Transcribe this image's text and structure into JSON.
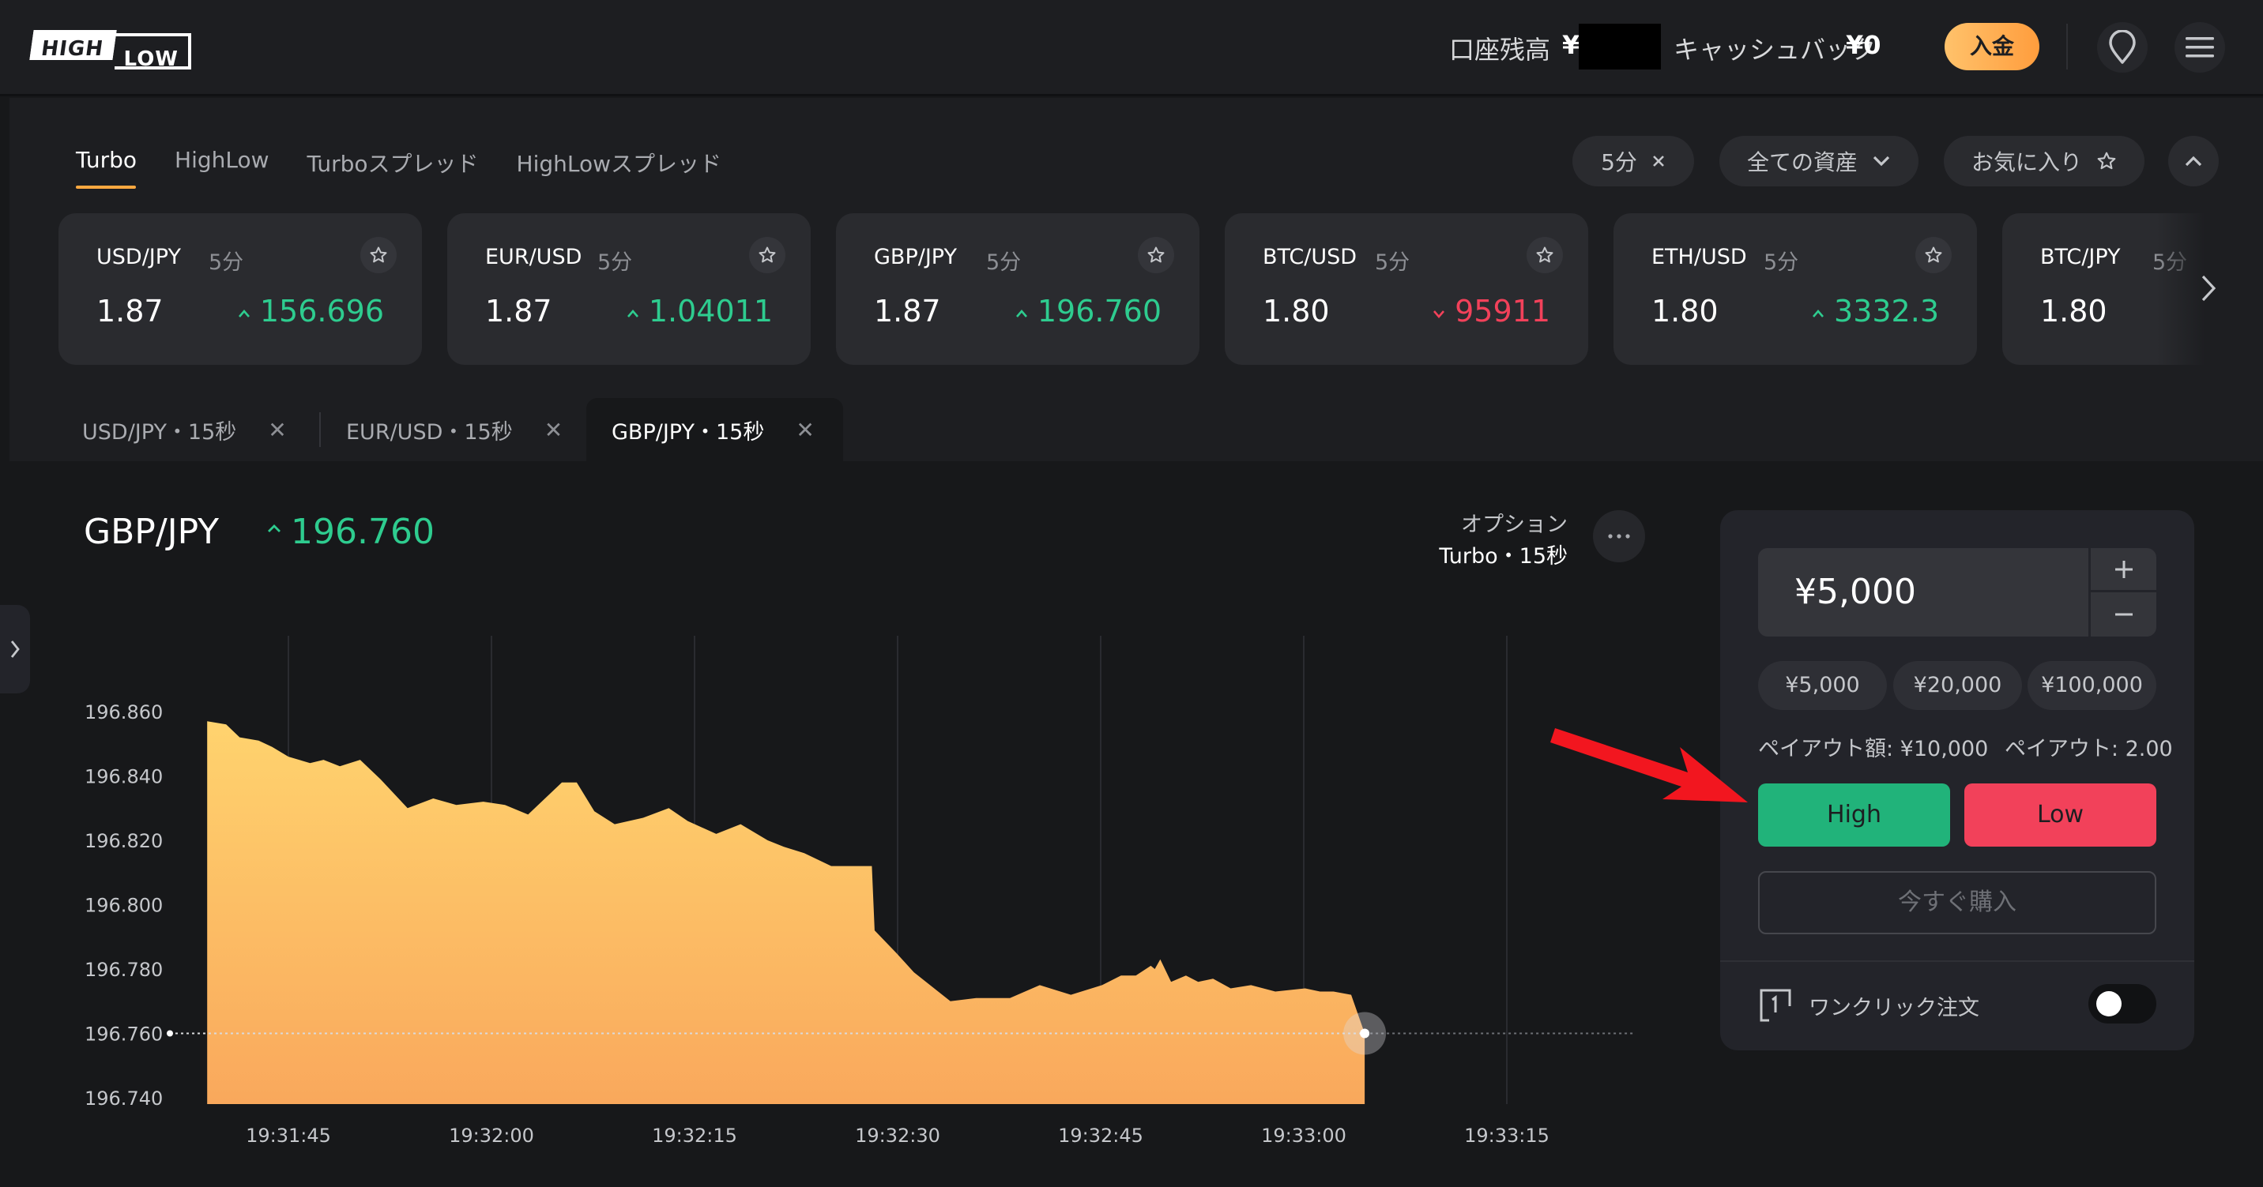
{
  "header": {
    "logo_top": "HIGH",
    "logo_bottom": "LOW",
    "balance_label": "口座残高",
    "balance_currency": "¥",
    "cashback_label": "キャッシュバック",
    "cashback_value": "¥0",
    "deposit_label": "入金",
    "icons": [
      "location-pin-icon",
      "menu-icon"
    ]
  },
  "trade_type_tabs": [
    {
      "label": "Turbo",
      "active": true
    },
    {
      "label": "HighLow",
      "active": false
    },
    {
      "label": "Turboスプレッド",
      "active": false
    },
    {
      "label": "HighLowスプレッド",
      "active": false
    }
  ],
  "filters": {
    "duration": "5分",
    "assets": "全ての資産",
    "favorites": "お気に入り"
  },
  "asset_cards": [
    {
      "pair": "USD/JPY",
      "duration": "5分",
      "payout": "1.87",
      "price": "156.696",
      "direction": "up"
    },
    {
      "pair": "EUR/USD",
      "duration": "5分",
      "payout": "1.87",
      "price": "1.04011",
      "direction": "up"
    },
    {
      "pair": "GBP/JPY",
      "duration": "5分",
      "payout": "1.87",
      "price": "196.760",
      "direction": "up"
    },
    {
      "pair": "BTC/USD",
      "duration": "5分",
      "payout": "1.80",
      "price": "95911",
      "direction": "down"
    },
    {
      "pair": "ETH/USD",
      "duration": "5分",
      "payout": "1.80",
      "price": "3332.3",
      "direction": "up"
    },
    {
      "pair": "BTC/JPY",
      "duration": "5分",
      "payout": "1.80",
      "price": "",
      "direction": "up"
    }
  ],
  "chart_tabs": [
    {
      "label": "USD/JPY・15秒",
      "active": false
    },
    {
      "label": "EUR/USD・15秒",
      "active": false
    },
    {
      "label": "GBP/JPY・15秒",
      "active": true
    }
  ],
  "chart_header": {
    "pair": "GBP/JPY",
    "price": "196.760",
    "option_label": "オプション",
    "option_value": "Turbo・15秒"
  },
  "trade_panel": {
    "amount": "¥5,000",
    "presets": [
      "¥5,000",
      "¥20,000",
      "¥100,000"
    ],
    "payout_amount": "ペイアウト額: ¥10,000",
    "payout_rate": "ペイアウト: 2.00",
    "high_label": "High",
    "low_label": "Low",
    "buy_now_label": "今すぐ購入",
    "one_click_label": "ワンクリック注文",
    "one_click_enabled": false
  },
  "colors": {
    "up": "#2ecc8f",
    "down": "#f2415a",
    "high_button": "#21b37a",
    "low_button": "#f2415a",
    "accent": "#ffa940",
    "area_top": "#ffd36e",
    "area_bottom": "#f9a85c",
    "annotation_arrow": "#f2161f"
  },
  "chart_data": {
    "type": "area",
    "ylim": [
      196.74,
      196.865
    ],
    "yticks": [
      "196.860",
      "196.840",
      "196.820",
      "196.800",
      "196.780",
      "196.760",
      "196.740"
    ],
    "xticks": [
      "19:31:45",
      "19:32:00",
      "19:32:15",
      "19:32:30",
      "19:32:45",
      "19:33:00",
      "19:33:15"
    ],
    "x_range_seconds": [
      -14,
      83
    ],
    "x_tick_seconds": [
      0,
      15,
      30,
      45,
      60,
      75,
      90
    ],
    "current_price": 196.76,
    "series": [
      {
        "x": [
          -6,
          -4.6,
          -3.6,
          -2.2,
          -1.2,
          0,
          1.6,
          2.6,
          3.8,
          5.3,
          6.8,
          8.8,
          10.7,
          12.4,
          14.4,
          16,
          17.7,
          20.2,
          21.3,
          22.6,
          24.1,
          26.2,
          28.1,
          29.5,
          31.6,
          33.4,
          35.4,
          36.6,
          38.1,
          40.1,
          41.3,
          43.1,
          43.3,
          44.9,
          46.2,
          48.9,
          50.8,
          53.3,
          55.5,
          57.8,
          60.1,
          61.5,
          62.6,
          63.7,
          64,
          64.4,
          65.2,
          66.3,
          67.2,
          68.3,
          69.6,
          71.1,
          72.9,
          75.1,
          76.2,
          77.2,
          78.5,
          79.5
        ],
        "y": [
          196.857,
          196.856,
          196.852,
          196.851,
          196.849,
          196.846,
          196.844,
          196.845,
          196.843,
          196.845,
          196.839,
          196.83,
          196.833,
          196.831,
          196.832,
          196.831,
          196.828,
          196.838,
          196.838,
          196.829,
          196.825,
          196.827,
          196.83,
          196.826,
          196.822,
          196.825,
          196.82,
          196.818,
          196.816,
          196.812,
          196.812,
          196.812,
          196.792,
          196.785,
          196.779,
          196.77,
          196.771,
          196.771,
          196.775,
          196.772,
          196.775,
          196.778,
          196.778,
          196.781,
          196.78,
          196.783,
          196.776,
          196.778,
          196.776,
          196.777,
          196.774,
          196.775,
          196.773,
          196.774,
          196.773,
          196.773,
          196.772,
          196.76
        ]
      }
    ]
  }
}
